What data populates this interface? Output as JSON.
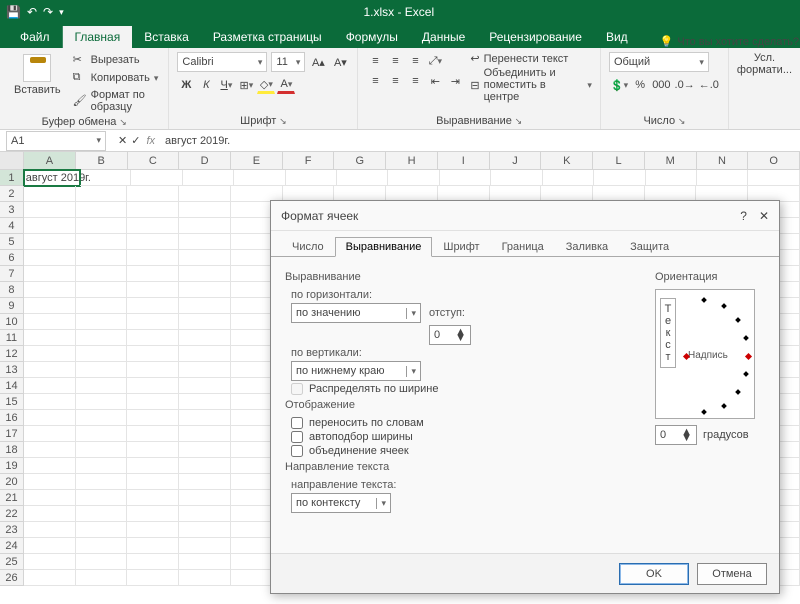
{
  "titlebar": {
    "title": "1.xlsx - Excel"
  },
  "tabs": {
    "file": "Файл",
    "home": "Главная",
    "insert": "Вставка",
    "layout": "Разметка страницы",
    "formulas": "Формулы",
    "data": "Данные",
    "review": "Рецензирование",
    "view": "Вид",
    "tell": "Что вы хотите сделать?"
  },
  "ribbon": {
    "clipboard": {
      "paste": "Вставить",
      "cut": "Вырезать",
      "copy": "Копировать",
      "painter": "Формат по образцу",
      "label": "Буфер обмена"
    },
    "font": {
      "name": "Calibri",
      "size": "11",
      "label": "Шрифт"
    },
    "align": {
      "wrap": "Перенести текст",
      "merge": "Объединить и поместить в центре",
      "label": "Выравнивание"
    },
    "number": {
      "format": "Общий",
      "label": "Число"
    },
    "styles": {
      "cond": "Усл.",
      "fmt": "формати..."
    }
  },
  "fbar": {
    "name": "A1",
    "fx": "fx",
    "value": "август 2019г."
  },
  "grid": {
    "cols": [
      "A",
      "B",
      "C",
      "D",
      "E",
      "F",
      "G",
      "H",
      "I",
      "J",
      "K",
      "L",
      "M",
      "N",
      "O"
    ],
    "rows": 26,
    "A1": "август 2019г."
  },
  "dialog": {
    "title": "Формат ячеек",
    "tabs": {
      "number": "Число",
      "align": "Выравнивание",
      "font": "Шрифт",
      "border": "Граница",
      "fill": "Заливка",
      "protect": "Защита"
    },
    "sect_align": "Выравнивание",
    "horiz_lbl": "по горизонтали:",
    "horiz_val": "по значению",
    "indent_lbl": "отступ:",
    "indent_val": "0",
    "vert_lbl": "по вертикали:",
    "vert_val": "по нижнему краю",
    "distribute": "Распределять по ширине",
    "sect_display": "Отображение",
    "wrap": "переносить по словам",
    "shrink": "автоподбор ширины",
    "mergecells": "объединение ячеек",
    "sect_dir": "Направление текста",
    "dir_lbl": "направление текста:",
    "dir_val": "по контексту",
    "orient_title": "Ориентация",
    "orient_vtext": "Текст",
    "orient_label": "Надпись",
    "deg_val": "0",
    "deg_unit": "градусов",
    "ok": "OK",
    "cancel": "Отмена"
  }
}
